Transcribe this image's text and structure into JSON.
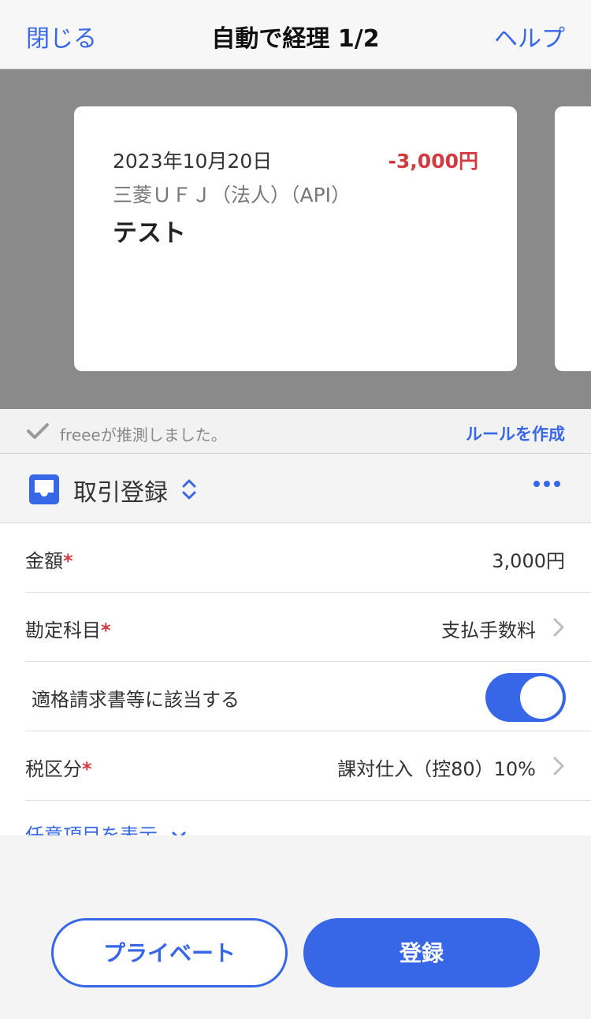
{
  "header": {
    "close_label": "閉じる",
    "title": "自動で経理 1/2",
    "help_label": "ヘルプ"
  },
  "card": {
    "date": "2023年10月20日",
    "amount": "-3,000円",
    "bank": "三菱ＵＦＪ（法人）（API）",
    "description": "テスト"
  },
  "guess": {
    "text": "freeeが推測しました。",
    "rule_link": "ルールを作成"
  },
  "section": {
    "label": "取引登録"
  },
  "form": {
    "amount": {
      "label": "金額",
      "required_mark": "*",
      "value": "3,000円"
    },
    "account": {
      "label": "勘定科目",
      "required_mark": "*",
      "value": "支払手数料"
    },
    "invoice": {
      "label": "適格請求書等に該当する",
      "enabled": true
    },
    "tax": {
      "label": "税区分",
      "required_mark": "*",
      "value": "課対仕入（控80）10%"
    },
    "optional_link": "任意項目を表示"
  },
  "buttons": {
    "private_label": "プライベート",
    "register_label": "登録"
  },
  "colors": {
    "accent": "#3767e6",
    "negative": "#d13a3f",
    "card_backdrop": "#8a8a8a"
  }
}
